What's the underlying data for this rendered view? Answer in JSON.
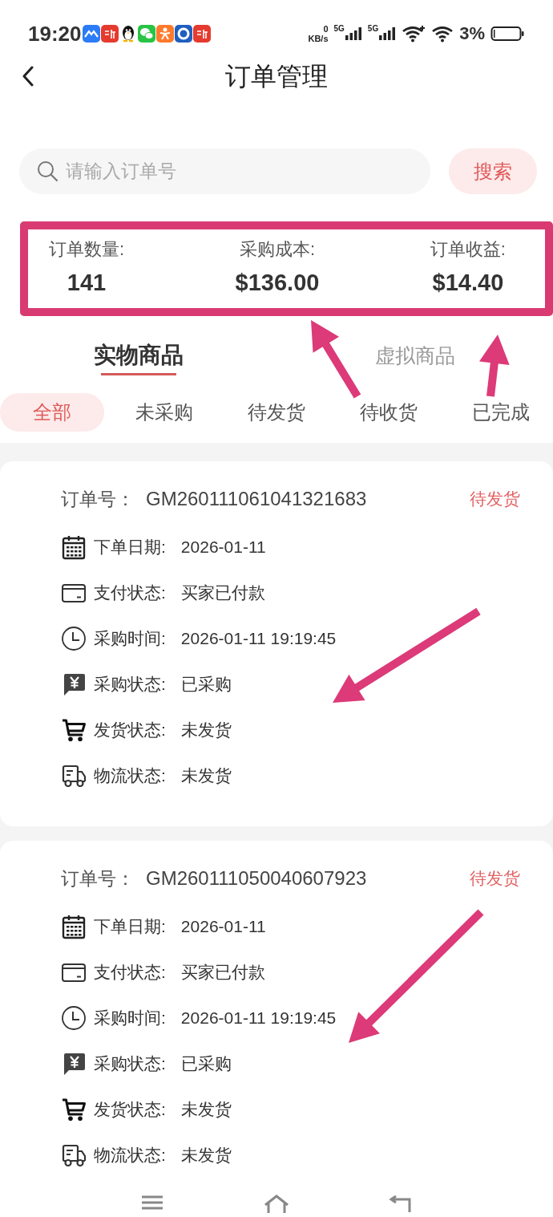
{
  "status_bar": {
    "time": "19:20",
    "net_speed": "0",
    "net_speed_unit": "KB/s",
    "networks": [
      "5G",
      "5G"
    ],
    "battery": "3%"
  },
  "header": {
    "title": "订单管理"
  },
  "search": {
    "placeholder": "请输入订单号",
    "button": "搜索"
  },
  "stats": {
    "highlighted": true,
    "items": [
      {
        "label": "订单数量:",
        "value": "141"
      },
      {
        "label": "采购成本:",
        "value": "$136.00"
      },
      {
        "label": "订单收益:",
        "value": "$14.40"
      }
    ]
  },
  "category_tabs": [
    {
      "label": "实物商品",
      "selected": true
    },
    {
      "label": "虚拟商品",
      "selected": false
    }
  ],
  "filter_tabs": [
    {
      "label": "全部",
      "selected": true
    },
    {
      "label": "未采购",
      "selected": false
    },
    {
      "label": "待发货",
      "selected": false
    },
    {
      "label": "待收货",
      "selected": false
    },
    {
      "label": "已完成",
      "selected": false
    }
  ],
  "orders": [
    {
      "number_label": "订单号：",
      "number": "GM260111061041321683",
      "status": "待发货",
      "fields": [
        {
          "kind": "calendar",
          "label": "下单日期:",
          "value": "2026-01-11"
        },
        {
          "kind": "card",
          "label": "支付状态:",
          "value": "买家已付款"
        },
        {
          "kind": "clock",
          "label": "采购时间:",
          "value": "2026-01-11 19:19:45"
        },
        {
          "kind": "yen",
          "label": "采购状态:",
          "value": "已采购"
        },
        {
          "kind": "cart",
          "label": "发货状态:",
          "value": "未发货"
        },
        {
          "kind": "truck",
          "label": "物流状态:",
          "value": "未发货"
        }
      ]
    },
    {
      "number_label": "订单号：",
      "number": "GM260111050040607923",
      "status": "待发货",
      "fields": [
        {
          "kind": "calendar",
          "label": "下单日期:",
          "value": "2026-01-11"
        },
        {
          "kind": "card",
          "label": "支付状态:",
          "value": "买家已付款"
        },
        {
          "kind": "clock",
          "label": "采购时间:",
          "value": "2026-01-11 19:19:45"
        },
        {
          "kind": "yen",
          "label": "采购状态:",
          "value": "已采购"
        },
        {
          "kind": "cart",
          "label": "发货状态:",
          "value": "未发货"
        },
        {
          "kind": "truck",
          "label": "物流状态:",
          "value": "未发货"
        }
      ]
    }
  ]
}
